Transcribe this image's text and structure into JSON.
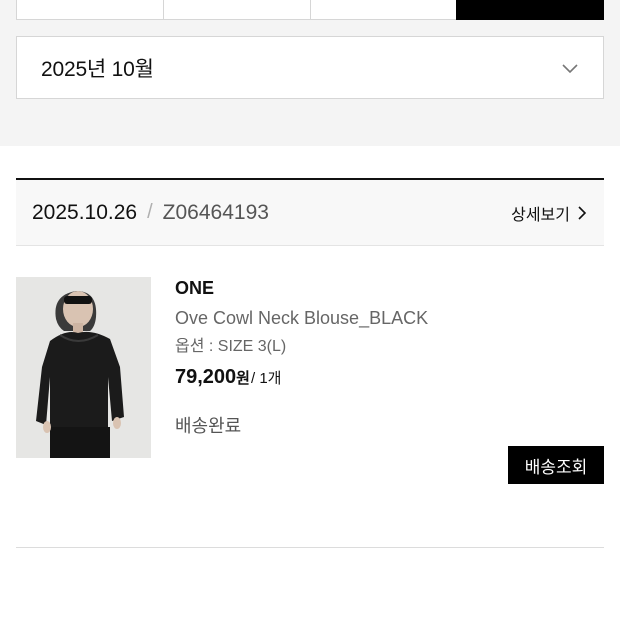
{
  "period_filter": {
    "tabs": [
      "",
      "",
      "",
      ""
    ],
    "active_index": 3
  },
  "month_select": {
    "value": "2025년 10월",
    "icon": "chevron-down-icon"
  },
  "order": {
    "date": "2025.10.26",
    "separator": "/",
    "number": "Z06464193",
    "detail_link": "상세보기",
    "detail_icon": "chevron-right-icon",
    "item": {
      "brand": "ONE",
      "name": "Ove Cowl Neck Blouse_BLACK",
      "option": "옵션 : SIZE 3(L)",
      "price": "79,200",
      "currency": "원",
      "quantity": "/ 1개",
      "status": "배송완료",
      "track_button": "배송조회"
    }
  },
  "colors": {
    "accent": "#000000",
    "background_band": "#f4f4f4",
    "muted_text": "#666666"
  }
}
